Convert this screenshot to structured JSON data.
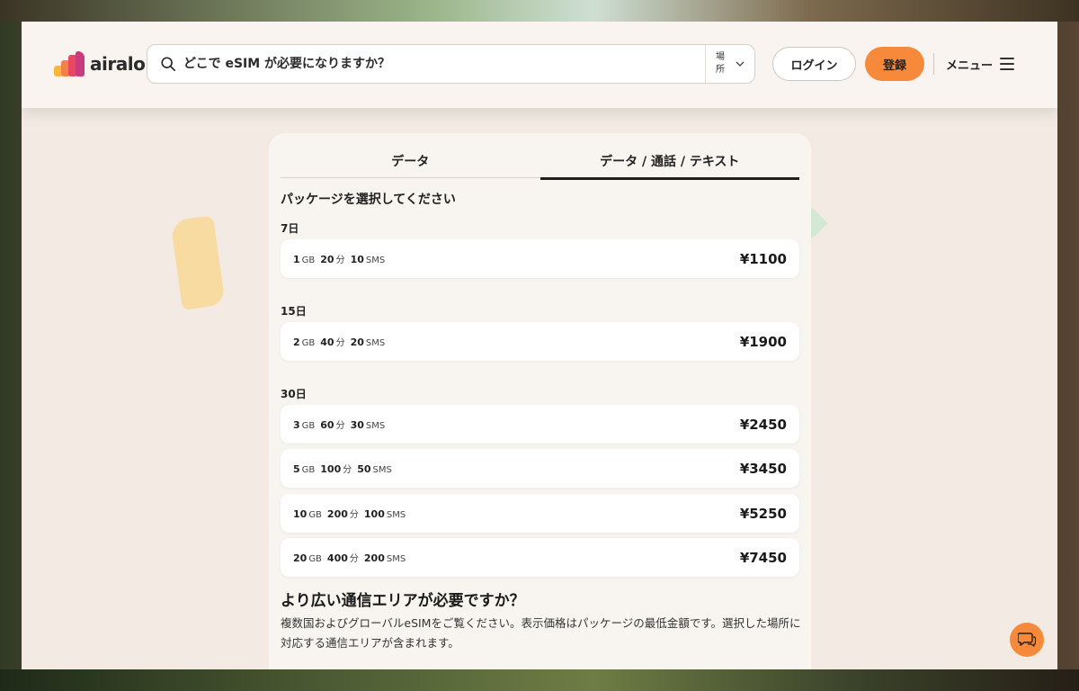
{
  "brand": {
    "name": "airalo"
  },
  "search": {
    "placeholder": "どこで eSIM が必要になりますか？",
    "location_label": "場所"
  },
  "header": {
    "login": "ログイン",
    "signup": "登録",
    "menu": "メニュー"
  },
  "tabs": [
    {
      "label": "データ",
      "active": false
    },
    {
      "label": "データ / 通話 / テキスト",
      "active": true
    }
  ],
  "select_title": "パッケージを選択してください",
  "groups": [
    {
      "label": "7日"
    },
    {
      "label": "15日"
    },
    {
      "label": "30日"
    }
  ],
  "plans": [
    {
      "data": "1",
      "data_unit": "GB",
      "min": "20",
      "min_unit": "分",
      "sms": "10",
      "sms_unit": "SMS",
      "price": "¥1100"
    },
    {
      "data": "2",
      "data_unit": "GB",
      "min": "40",
      "min_unit": "分",
      "sms": "20",
      "sms_unit": "SMS",
      "price": "¥1900"
    },
    {
      "data": "3",
      "data_unit": "GB",
      "min": "60",
      "min_unit": "分",
      "sms": "30",
      "sms_unit": "SMS",
      "price": "¥2450"
    },
    {
      "data": "5",
      "data_unit": "GB",
      "min": "100",
      "min_unit": "分",
      "sms": "50",
      "sms_unit": "SMS",
      "price": "¥3450"
    },
    {
      "data": "10",
      "data_unit": "GB",
      "min": "200",
      "min_unit": "分",
      "sms": "100",
      "sms_unit": "SMS",
      "price": "¥5250"
    },
    {
      "data": "20",
      "data_unit": "GB",
      "min": "400",
      "min_unit": "分",
      "sms": "200",
      "sms_unit": "SMS",
      "price": "¥7450"
    }
  ],
  "wider": {
    "title": "より広い通信エリアが必要ですか？",
    "desc": "複数国およびグローバルeSIMをご覧ください。表示価格はパッケージの最低金額です。選択した場所に対応する通信エリアが含まれます。"
  },
  "colors": {
    "accent": "#f78a3a",
    "page_bg": "#f3ebe3",
    "header_bg": "#f9f4ef"
  },
  "icons": {
    "search": "search-icon",
    "chevron": "chevron-down-icon",
    "menu": "hamburger-icon",
    "chat": "chat-icon"
  }
}
